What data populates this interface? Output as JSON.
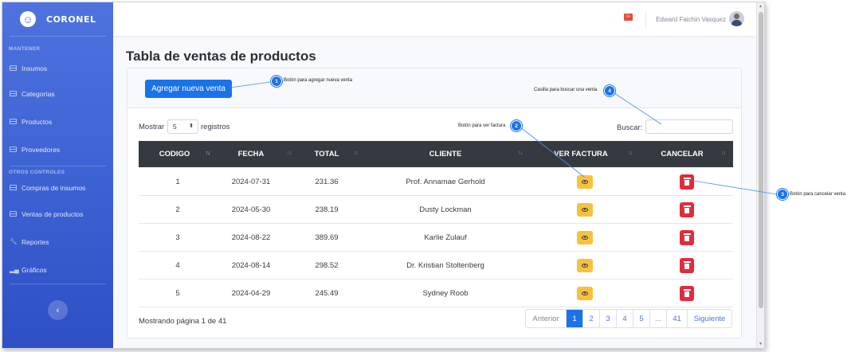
{
  "app": {
    "brand": "CORONEL",
    "brand_icon": "smiley-icon"
  },
  "sidebar": {
    "heading_manage": "MANTENER",
    "items_manage": [
      {
        "label": "Insumos",
        "icon": "table-icon"
      },
      {
        "label": "Categorías",
        "icon": "table-icon"
      },
      {
        "label": "Productos",
        "icon": "table-icon"
      },
      {
        "label": "Proveedores",
        "icon": "table-icon"
      }
    ],
    "heading_other": "OTROS CONTROLES",
    "items_other": [
      {
        "label": "Compras de insumos",
        "icon": "table-icon"
      },
      {
        "label": "Ventas de productos",
        "icon": "table-icon"
      },
      {
        "label": "Reportes",
        "icon": "wrench-icon"
      },
      {
        "label": "Gráficos",
        "icon": "chart-icon"
      }
    ],
    "toggle": "‹"
  },
  "topbar": {
    "user_name": "Edward Faichin Vasquez",
    "flag_badge": "1+"
  },
  "page": {
    "title": "Tabla de ventas de productos"
  },
  "card": {
    "add_button": "Agregar nueva venta",
    "show_label": "Mostrar",
    "length_value": "5",
    "show_suffix": "registros",
    "search_label": "Buscar:",
    "search_value": ""
  },
  "table": {
    "headers": [
      "CODIGO",
      "FECHA",
      "TOTAL",
      "CLIENTE",
      "VER FACTURA",
      "CANCELAR"
    ],
    "rows": [
      {
        "codigo": "1",
        "fecha": "2024-07-31",
        "total": "231.36",
        "cliente": "Prof. Annamae Gerhold"
      },
      {
        "codigo": "2",
        "fecha": "2024-05-30",
        "total": "238.19",
        "cliente": "Dusty Lockman"
      },
      {
        "codigo": "3",
        "fecha": "2024-08-22",
        "total": "389.69",
        "cliente": "Karlie Zulauf"
      },
      {
        "codigo": "4",
        "fecha": "2024-08-14",
        "total": "298.52",
        "cliente": "Dr. Kristian Stoltenberg"
      },
      {
        "codigo": "5",
        "fecha": "2024-04-29",
        "total": "245.49",
        "cliente": "Sydney Roob"
      }
    ]
  },
  "footer": {
    "info": "Mostrando página 1 de 41",
    "pagination": [
      "Anterior",
      "1",
      "2",
      "3",
      "4",
      "5",
      "...",
      "41",
      "Siguiente"
    ],
    "active_page": "1"
  },
  "annotations": [
    {
      "n": "1",
      "text": "Botón para agregar nueva venta"
    },
    {
      "n": "2",
      "text": "Botón para ver factura"
    },
    {
      "n": "3",
      "text": "Botón para cancelar venta"
    },
    {
      "n": "4",
      "text": "Casilla para buscar una venta"
    }
  ],
  "colors": {
    "sidebar": "#4e73df",
    "primary": "#1a73e8",
    "header_dark": "#343a40",
    "warning": "#f6c23e",
    "danger": "#e02d3c"
  }
}
